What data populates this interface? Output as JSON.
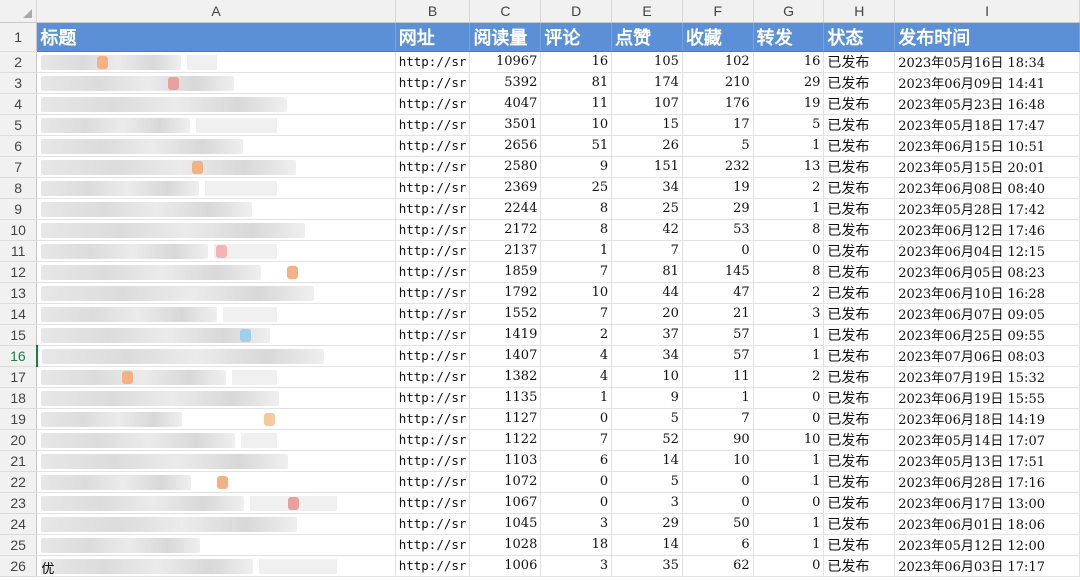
{
  "sheet": {
    "column_letters": [
      "A",
      "B",
      "C",
      "D",
      "E",
      "F",
      "G",
      "H",
      "I"
    ],
    "headers": [
      "标题",
      "网址",
      "阅读量",
      "评论",
      "点赞",
      "收藏",
      "转发",
      "状态",
      "发布时间"
    ],
    "active_row": 16,
    "rows": [
      {
        "n": "2",
        "title": "",
        "url": "http://sr",
        "reads": "10967",
        "comments": "16",
        "likes": "105",
        "favorites": "102",
        "shares": "16",
        "status": "已发布",
        "time": "2023年05月16日  18:34"
      },
      {
        "n": "3",
        "title": "",
        "url": "http://sr",
        "reads": "5392",
        "comments": "81",
        "likes": "174",
        "favorites": "210",
        "shares": "29",
        "status": "已发布",
        "time": "2023年06月09日  14:41"
      },
      {
        "n": "4",
        "title": "",
        "url": "http://sr",
        "reads": "4047",
        "comments": "11",
        "likes": "107",
        "favorites": "176",
        "shares": "19",
        "status": "已发布",
        "time": "2023年05月23日  16:48"
      },
      {
        "n": "5",
        "title": "",
        "url": "http://sr",
        "reads": "3501",
        "comments": "10",
        "likes": "15",
        "favorites": "17",
        "shares": "5",
        "status": "已发布",
        "time": "2023年05月18日  17:47"
      },
      {
        "n": "6",
        "title": "",
        "url": "http://sr",
        "reads": "2656",
        "comments": "51",
        "likes": "26",
        "favorites": "5",
        "shares": "1",
        "status": "已发布",
        "time": "2023年06月15日  10:51"
      },
      {
        "n": "7",
        "title": "",
        "url": "http://sr",
        "reads": "2580",
        "comments": "9",
        "likes": "151",
        "favorites": "232",
        "shares": "13",
        "status": "已发布",
        "time": "2023年05月15日  20:01"
      },
      {
        "n": "8",
        "title": "",
        "url": "http://sr",
        "reads": "2369",
        "comments": "25",
        "likes": "34",
        "favorites": "19",
        "shares": "2",
        "status": "已发布",
        "time": "2023年06月08日  08:40"
      },
      {
        "n": "9",
        "title": "",
        "url": "http://sr",
        "reads": "2244",
        "comments": "8",
        "likes": "25",
        "favorites": "29",
        "shares": "1",
        "status": "已发布",
        "time": "2023年05月28日  17:42"
      },
      {
        "n": "10",
        "title": "",
        "url": "http://sr",
        "reads": "2172",
        "comments": "8",
        "likes": "42",
        "favorites": "53",
        "shares": "8",
        "status": "已发布",
        "time": "2023年06月12日  17:46"
      },
      {
        "n": "11",
        "title": "",
        "url": "http://sr",
        "reads": "2137",
        "comments": "1",
        "likes": "7",
        "favorites": "0",
        "shares": "0",
        "status": "已发布",
        "time": "2023年06月04日  12:15"
      },
      {
        "n": "12",
        "title": "",
        "url": "http://sr",
        "reads": "1859",
        "comments": "7",
        "likes": "81",
        "favorites": "145",
        "shares": "8",
        "status": "已发布",
        "time": "2023年06月05日  08:23"
      },
      {
        "n": "13",
        "title": "",
        "url": "http://sr",
        "reads": "1792",
        "comments": "10",
        "likes": "44",
        "favorites": "47",
        "shares": "2",
        "status": "已发布",
        "time": "2023年06月10日  16:28"
      },
      {
        "n": "14",
        "title": "",
        "url": "http://sr",
        "reads": "1552",
        "comments": "7",
        "likes": "20",
        "favorites": "21",
        "shares": "3",
        "status": "已发布",
        "time": "2023年06月07日  09:05"
      },
      {
        "n": "15",
        "title": "",
        "url": "http://sr",
        "reads": "1419",
        "comments": "2",
        "likes": "37",
        "favorites": "57",
        "shares": "1",
        "status": "已发布",
        "time": "2023年06月25日  09:55"
      },
      {
        "n": "16",
        "title": "",
        "url": "http://sr",
        "reads": "1407",
        "comments": "4",
        "likes": "34",
        "favorites": "57",
        "shares": "1",
        "status": "已发布",
        "time": "2023年07月06日  08:03"
      },
      {
        "n": "17",
        "title": "",
        "url": "http://sr",
        "reads": "1382",
        "comments": "4",
        "likes": "10",
        "favorites": "11",
        "shares": "2",
        "status": "已发布",
        "time": "2023年07月19日  15:32"
      },
      {
        "n": "18",
        "title": "",
        "url": "http://sr",
        "reads": "1135",
        "comments": "1",
        "likes": "9",
        "favorites": "1",
        "shares": "0",
        "status": "已发布",
        "time": "2023年06月19日  15:55"
      },
      {
        "n": "19",
        "title": "",
        "url": "http://sr",
        "reads": "1127",
        "comments": "0",
        "likes": "5",
        "favorites": "7",
        "shares": "0",
        "status": "已发布",
        "time": "2023年06月18日  14:19"
      },
      {
        "n": "20",
        "title": "",
        "url": "http://sr",
        "reads": "1122",
        "comments": "7",
        "likes": "52",
        "favorites": "90",
        "shares": "10",
        "status": "已发布",
        "time": "2023年05月14日  17:07"
      },
      {
        "n": "21",
        "title": "",
        "url": "http://sr",
        "reads": "1103",
        "comments": "6",
        "likes": "14",
        "favorites": "10",
        "shares": "1",
        "status": "已发布",
        "time": "2023年05月13日  17:51"
      },
      {
        "n": "22",
        "title": "",
        "url": "http://sr",
        "reads": "1072",
        "comments": "0",
        "likes": "5",
        "favorites": "0",
        "shares": "1",
        "status": "已发布",
        "time": "2023年06月28日  17:16"
      },
      {
        "n": "23",
        "title": "",
        "url": "http://sr",
        "reads": "1067",
        "comments": "0",
        "likes": "3",
        "favorites": "0",
        "shares": "0",
        "status": "已发布",
        "time": "2023年06月17日  13:00"
      },
      {
        "n": "24",
        "title": "",
        "url": "http://sr",
        "reads": "1045",
        "comments": "3",
        "likes": "29",
        "favorites": "50",
        "shares": "1",
        "status": "已发布",
        "time": "2023年06月01日  18:06"
      },
      {
        "n": "25",
        "title": "",
        "url": "http://sr",
        "reads": "1028",
        "comments": "18",
        "likes": "14",
        "favorites": "6",
        "shares": "1",
        "status": "已发布",
        "time": "2023年05月12日  12:00"
      },
      {
        "n": "26",
        "title": "优",
        "url": "http://sr",
        "reads": "1006",
        "comments": "3",
        "likes": "35",
        "favorites": "62",
        "shares": "0",
        "status": "已发布",
        "time": "2023年06月03日  17:17"
      }
    ],
    "colors": {
      "header_bg": "#5b8fd6",
      "header_text": "#ffffff",
      "active_row_accent": "#1e7b46",
      "gridline": "#e2e2e2"
    }
  }
}
